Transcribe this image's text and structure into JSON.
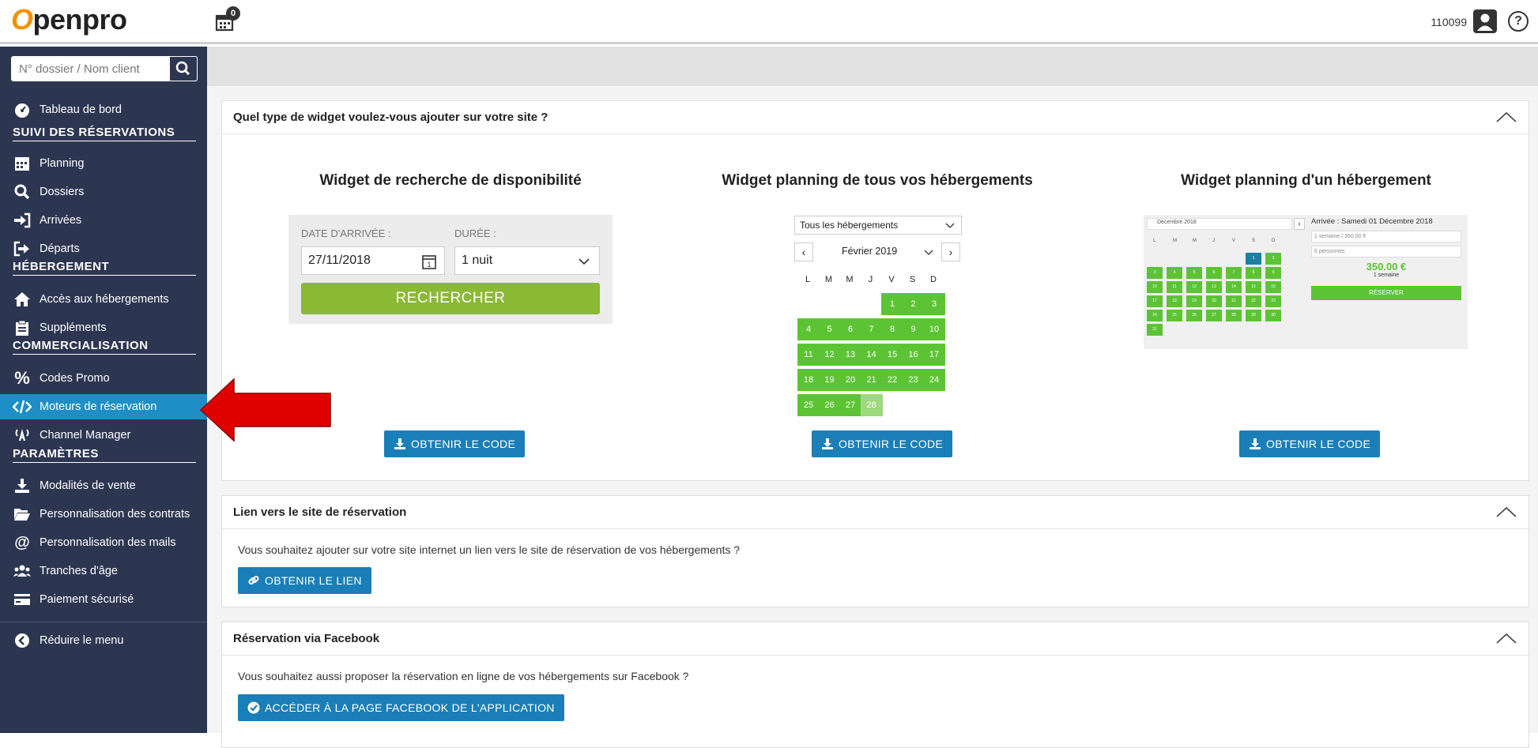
{
  "header": {
    "logo_o": "O",
    "logo_rest": "penpro",
    "badge_count": "0",
    "user_id": "110099",
    "help_label": "?"
  },
  "sidebar": {
    "search_placeholder": "N° dossier / Nom client",
    "items": [
      {
        "label": "Tableau de bord",
        "icon": "dashboard-icon"
      },
      {
        "label": "SUIVI DES RÉSERVATIONS",
        "section": true
      },
      {
        "label": "Planning",
        "icon": "calendar-icon"
      },
      {
        "label": "Dossiers",
        "icon": "search-icon"
      },
      {
        "label": "Arrivées",
        "icon": "sign-in-icon"
      },
      {
        "label": "Départs",
        "icon": "sign-out-icon"
      },
      {
        "label": "HÉBERGEMENT",
        "section": true
      },
      {
        "label": "Accès aux hébergements",
        "icon": "home-icon"
      },
      {
        "label": "Suppléments",
        "icon": "clipboard-icon"
      },
      {
        "label": "COMMERCIALISATION",
        "section": true
      },
      {
        "label": "Codes Promo",
        "icon": "percent-icon"
      },
      {
        "label": "Moteurs de réservation",
        "icon": "code-icon",
        "active": true
      },
      {
        "label": "Channel Manager",
        "icon": "antenna-icon"
      },
      {
        "label": "PARAMÈTRES",
        "section": true
      },
      {
        "label": "Modalités de vente",
        "icon": "download-icon"
      },
      {
        "label": "Personnalisation des contrats",
        "icon": "folder-icon"
      },
      {
        "label": "Personnalisation des mails",
        "icon": "at-icon"
      },
      {
        "label": "Tranches d'âge",
        "icon": "users-icon"
      },
      {
        "label": "Paiement sécurisé",
        "icon": "credit-card-icon"
      },
      {
        "label": "Réduire le menu",
        "icon": "chevron-left-icon"
      }
    ]
  },
  "widgets_panel": {
    "title": "Quel type de widget voulez-vous ajouter sur votre site ?",
    "widget1": {
      "title": "Widget de recherche de disponibilité",
      "arrival_label": "DATE D'ARRIVÉE :",
      "arrival_value": "27/11/2018",
      "duration_label": "DURÉE :",
      "duration_value": "1 nuit",
      "search_button": "RECHERCHER"
    },
    "widget2": {
      "title": "Widget planning de tous vos hébergements",
      "select_value": "Tous les hébergements",
      "month": "Février 2019",
      "weekdays": [
        "L",
        "M",
        "M",
        "J",
        "V",
        "S",
        "D"
      ]
    },
    "widget3": {
      "title": "Widget planning d'un hébergement",
      "month": "Décembre 2018",
      "arrival": "Arrivée : Samedi 01 Décembre 2018",
      "week_option": "1 semaine / 350.00 €",
      "people_option": "6 personnes",
      "price": "350.00 €",
      "price_sub": "1 semaine",
      "book_button": "RÉSERVER",
      "weekdays": [
        "L",
        "M",
        "M",
        "J",
        "V",
        "S",
        "D"
      ]
    },
    "get_code_label": "OBTENIR LE CODE"
  },
  "link_panel": {
    "title": "Lien vers le site de réservation",
    "text": "Vous souhaitez ajouter sur votre site internet un lien vers le site de réservation de vos hébergements ?",
    "button": "OBTENIR LE LIEN"
  },
  "facebook_panel": {
    "title": "Réservation via Facebook",
    "text": "Vous souhaitez aussi proposer la réservation en ligne de vos hébergements sur Facebook ?",
    "button": "ACCÉDER À LA PAGE FACEBOOK DE L'APPLICATION"
  },
  "colors": {
    "sidebar_bg": "#2d3651",
    "active_bg": "#1e8fc6",
    "button_blue": "#1a7fb8",
    "calendar_green": "#5cc434",
    "search_green": "#8ab933",
    "arrow_red": "#e00000",
    "logo_orange": "#f39200"
  }
}
